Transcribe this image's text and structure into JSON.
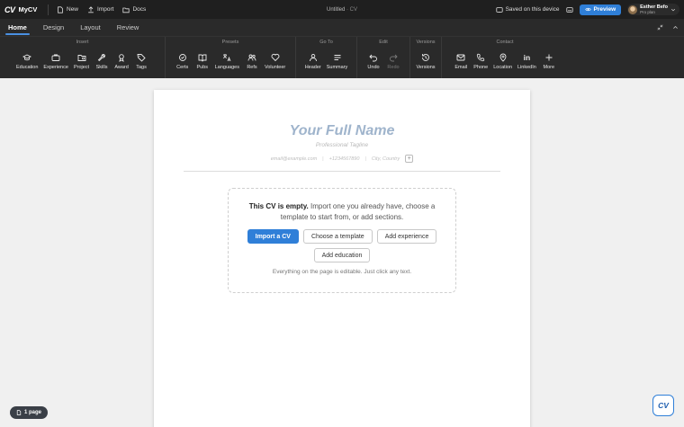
{
  "app": {
    "brand": "MyCV",
    "logo": "CV"
  },
  "topbar": {
    "new_label": "New",
    "import_label": "Import",
    "docs_label": "Docs",
    "doc_name": "Untitled",
    "doc_sep": "·",
    "doc_suffix": "CV",
    "saved_label": "Saved on this device",
    "preview_label": "Preview",
    "user_name": "Esther Befo",
    "user_plan": "Pro plan"
  },
  "tabs": [
    {
      "label": "Home"
    },
    {
      "label": "Design"
    },
    {
      "label": "Layout"
    },
    {
      "label": "Review"
    }
  ],
  "ribbon": {
    "insert": {
      "title": "Insert",
      "items": [
        "Education",
        "Experience",
        "Project",
        "Skills",
        "Award",
        "Tags"
      ]
    },
    "presets": {
      "title": "Presets",
      "items": [
        "Certs",
        "Pubs",
        "Languages",
        "Refs",
        "Volunteer"
      ]
    },
    "goto": {
      "title": "Go To",
      "items": [
        "Header",
        "Summary"
      ]
    },
    "edit": {
      "title": "Edit",
      "items": [
        "Undo",
        "Redo"
      ]
    },
    "versions": {
      "title": "Versions",
      "items": [
        "Versions"
      ]
    },
    "contact": {
      "title": "Contact",
      "items": [
        "Email",
        "Phone",
        "Location",
        "LinkedIn",
        "More"
      ]
    },
    "linkedin_glyph": "in"
  },
  "cv": {
    "name": "Your Full Name",
    "tagline": "Professional Tagline",
    "email": "email@example.com",
    "phone": "+1234567890",
    "location": "City, Country",
    "sep": "|",
    "add_glyph": "+"
  },
  "empty_state": {
    "title": "This CV is empty.",
    "body": " Import one you already have, choose a template to start from, or add sections.",
    "import_label": "Import a CV",
    "template_label": "Choose a template",
    "experience_label": "Add experience",
    "education_label": "Add education",
    "hint": "Everything on the page is editable. Just click any text."
  },
  "footer": {
    "pages_label": "1 page",
    "fab_label": "CV"
  },
  "colors": {
    "accent": "#2f7fd8",
    "topbar_bg": "#1f1f1f",
    "ribbon_bg": "#2a2a2a",
    "name_color": "#9fb4cc"
  }
}
